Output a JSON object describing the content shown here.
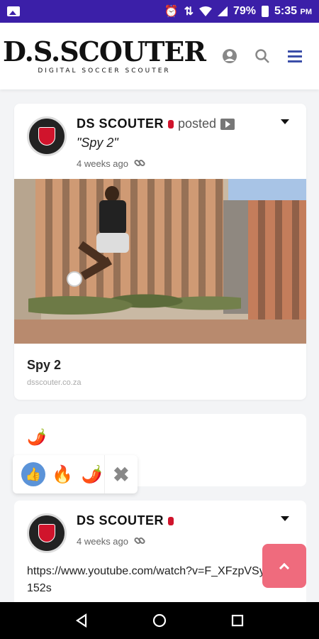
{
  "status_bar": {
    "battery": "79%",
    "time": "5:35",
    "ampm": "PM",
    "icons": [
      "image-icon",
      "alarm-icon",
      "data-arrows-icon",
      "wifi-icon",
      "signal-icon",
      "battery-icon"
    ]
  },
  "header": {
    "logo_main": "D.S.SCOUTER",
    "logo_sub": "DIGITAL SOCCER SCOUTER",
    "icons": [
      "user-icon",
      "search-icon",
      "menu-icon"
    ],
    "accent": "#3b4ea8"
  },
  "post1": {
    "author": "DS SCOUTER",
    "action": "posted",
    "title_quote": "\"Spy 2\"",
    "time": "4 weeks ago",
    "link_title": "Spy 2",
    "link_domain": "dsscouter.co.za"
  },
  "reactions": {
    "summary": "🌶️",
    "options": [
      "👍",
      "🔥",
      "🌶️"
    ],
    "close": "✖"
  },
  "post2": {
    "author": "DS SCOUTER",
    "time": "4 weeks ago",
    "text": "https://www.youtube.com/watch?v=F_XFzpVSylY&t=152s"
  },
  "nav": {
    "buttons": [
      "back",
      "home",
      "recents"
    ]
  },
  "colors": {
    "status_bar": "#3b1fa8",
    "scroll_top": "#ef6b7d",
    "brand_red": "#d0142c"
  }
}
